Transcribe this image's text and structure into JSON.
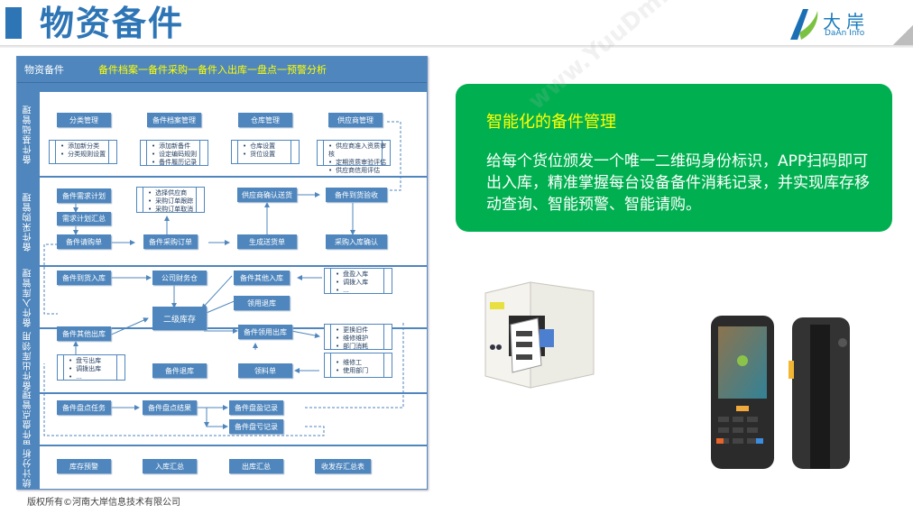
{
  "header": {
    "title": "物资备件",
    "logo_cn": "大岸",
    "logo_en": "DaAn Info"
  },
  "diagram": {
    "name": "物资备件",
    "flow": "备件档案一备件采购一备件入出库一盘点一预警分析",
    "lanes": [
      {
        "label": "备件基础管理"
      },
      {
        "label": "备件采购管理"
      },
      {
        "label": "备件入库管理"
      },
      {
        "label": "备件出库领用"
      },
      {
        "label": "备件盘点管理"
      },
      {
        "label": "统计分析"
      }
    ],
    "boxes": {
      "category_mgmt": "分类管理",
      "archive_mgmt": "备件档案管理",
      "warehouse_mgmt": "仓库管理",
      "supplier_mgmt": "供应商管理",
      "demand_plan": "备件需求计划",
      "demand_summary": "需求计划汇总",
      "purchase_request": "备件请购单",
      "purchase_order": "备件采购订单",
      "supplier_confirm": "供应商确认送货",
      "arrival_check": "备件到货验收",
      "delivery_note": "生成送货单",
      "inbound_confirm": "采购入库确认",
      "arrival_inbound": "备件到货入库",
      "finance_warehouse": "公司财务仓",
      "other_inbound": "备件其他入库",
      "return_inbound": "领用退库",
      "secondary_stock": "二级库存",
      "other_outbound": "备件其他出库",
      "requisition_out": "备件领用出库",
      "spare_return": "备件退库",
      "requisition_form": "领料单",
      "count_task": "备件盘点任务",
      "count_result": "备件盘点结果",
      "surplus_record": "备件盘盈记录",
      "loss_record": "备件盘亏记录",
      "stock_alert": "库存预警",
      "inbound_summary": "入库汇总",
      "outbound_summary": "出库汇总",
      "balance_summary": "收发存汇总表"
    },
    "lists": {
      "category": [
        "添加新分类",
        "分类规则设置"
      ],
      "archive": [
        "添加新备件",
        "设定编码规则",
        "备件履历记录"
      ],
      "warehouse": [
        "仓库设置",
        "货位设置"
      ],
      "supplier": [
        "供应商准入资质审核",
        "定期资质审验评估",
        "供应商信用评估"
      ],
      "order": [
        "选择供应商",
        "采购订单跟踪",
        "采购订单取消"
      ],
      "other_in": [
        "盘盈入库",
        "调拨入库",
        "..."
      ],
      "other_out": [
        "盘亏出库",
        "调拨出库",
        "..."
      ],
      "usage": [
        "更换旧件",
        "维修维护",
        "部门消耗"
      ],
      "requester": [
        "维修工",
        "使用部门"
      ]
    }
  },
  "panel": {
    "title": "智能化的备件管理",
    "body": "给每个货位颁发一个唯一二维码身份标识，APP扫码即可出入库，精准掌握每台设备备件消耗记录，并实现库存移动查询、智能预警、智能请购。"
  },
  "footer": {
    "copyright": "版权所有©河南大岸信息技术有限公司"
  }
}
